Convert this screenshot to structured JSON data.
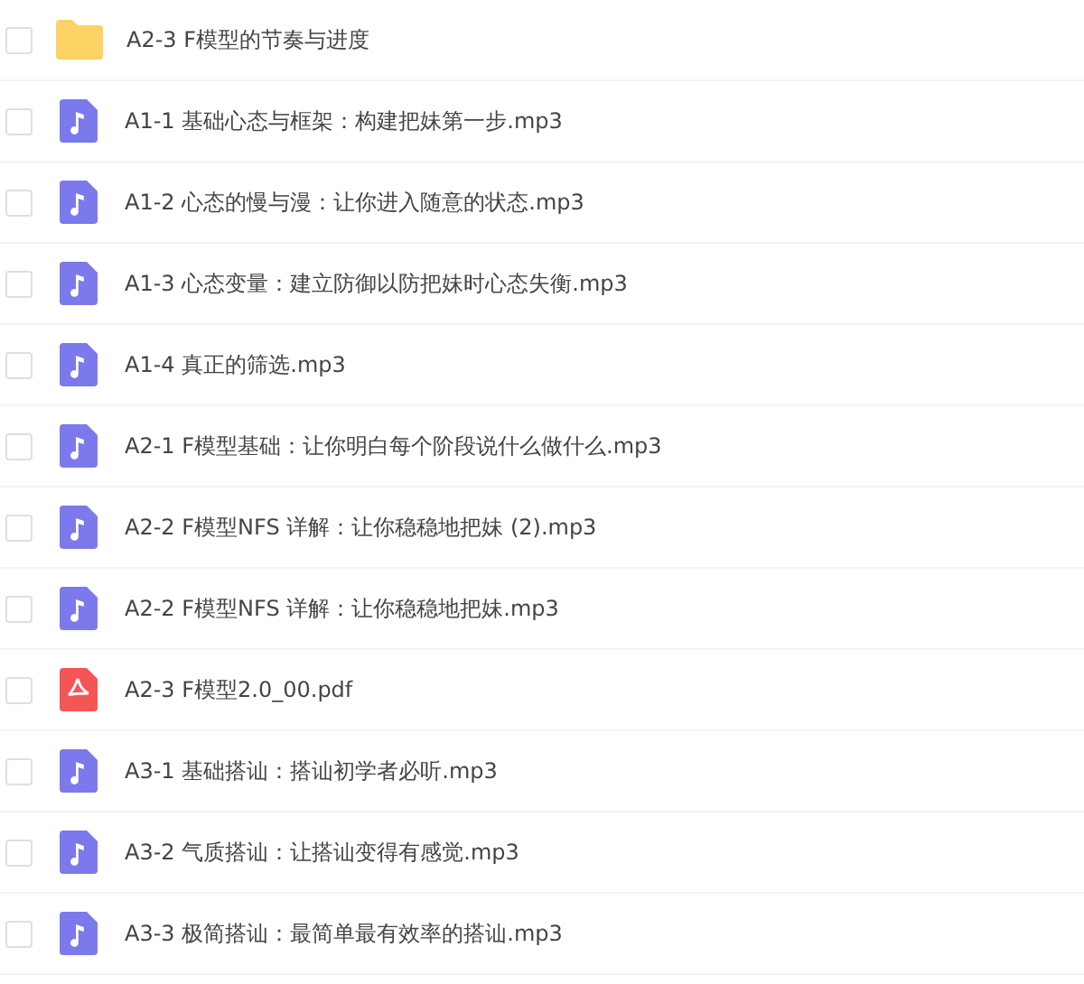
{
  "files": [
    {
      "kind": "folder",
      "name": "A2-3 F模型的节奏与进度",
      "checked": false
    },
    {
      "kind": "audio",
      "name": "A1-1 基础心态与框架：构建把妹第一步.mp3",
      "checked": false
    },
    {
      "kind": "audio",
      "name": "A1-2 心态的慢与漫：让你进入随意的状态.mp3",
      "checked": false
    },
    {
      "kind": "audio",
      "name": "A1-3 心态变量：建立防御以防把妹时心态失衡.mp3",
      "checked": false
    },
    {
      "kind": "audio",
      "name": "A1-4 真正的筛选.mp3",
      "checked": false
    },
    {
      "kind": "audio",
      "name": "A2-1 F模型基础：让你明白每个阶段说什么做什么.mp3",
      "checked": false
    },
    {
      "kind": "audio",
      "name": "A2-2 F模型NFS 详解：让你稳稳地把妹 (2).mp3",
      "checked": false
    },
    {
      "kind": "audio",
      "name": "A2-2 F模型NFS 详解：让你稳稳地把妹.mp3",
      "checked": false
    },
    {
      "kind": "pdf",
      "name": "A2-3 F模型2.0_00.pdf",
      "checked": false
    },
    {
      "kind": "audio",
      "name": "A3-1 基础搭讪：搭讪初学者必听.mp3",
      "checked": false
    },
    {
      "kind": "audio",
      "name": "A3-2 气质搭讪：让搭讪变得有感觉.mp3",
      "checked": false
    },
    {
      "kind": "audio",
      "name": "A3-3 极简搭讪：最简单最有效率的搭讪.mp3",
      "checked": false
    }
  ]
}
